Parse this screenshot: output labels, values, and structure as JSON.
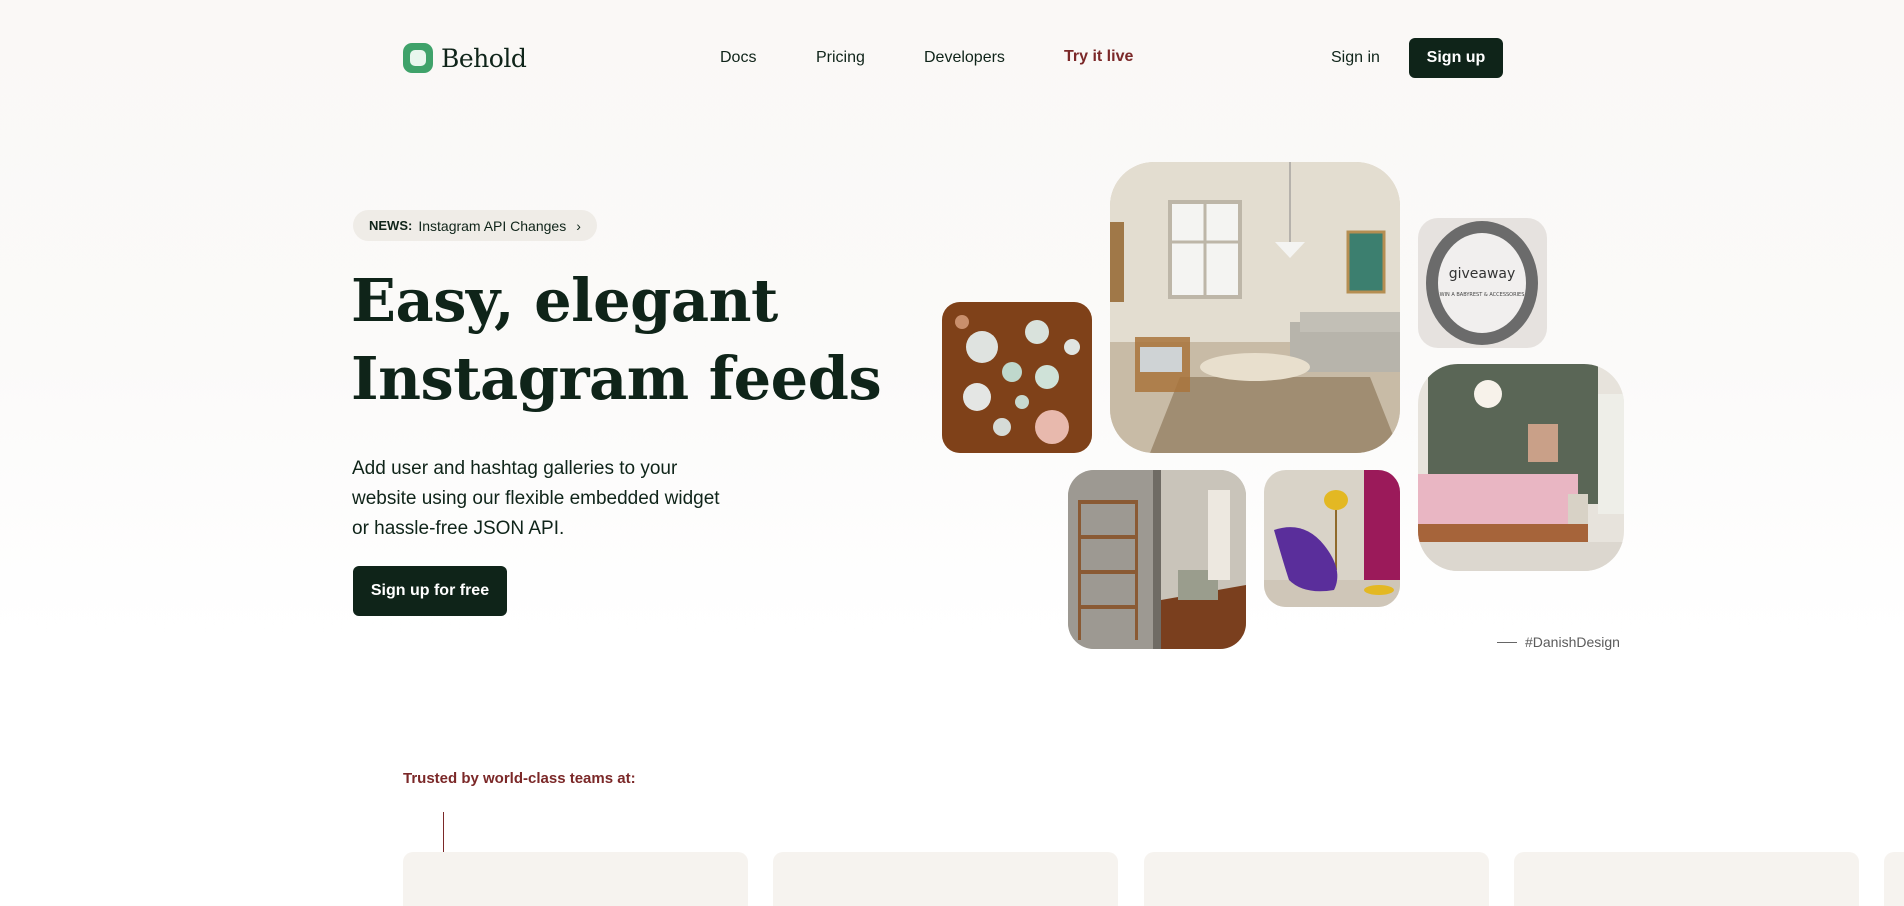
{
  "nav": {
    "brand": "Behold",
    "links": [
      {
        "label": "Docs"
      },
      {
        "label": "Pricing"
      },
      {
        "label": "Developers"
      },
      {
        "label": "Try it live"
      }
    ],
    "signin": "Sign in",
    "signup": "Sign up"
  },
  "hero": {
    "news_label": "NEWS:",
    "news_text": "Instagram API Changes",
    "title_line1": "Easy, elegant",
    "title_line2": "Instagram feeds",
    "subtitle": "Add user and hashtag galleries to your website using our flexible embedded widget or hassle-free JSON API.",
    "cta": "Sign up for free"
  },
  "gallery": {
    "caption": "#DanishDesign",
    "giveaway_text": "giveaway",
    "giveaway_sub": "WIN A BABYREST & ACCESSORIES"
  },
  "trusted": {
    "heading": "Trusted by world-class teams at:"
  },
  "colors": {
    "brand_green": "#3fa26a",
    "dark": "#0f2419",
    "accent": "#7b2828"
  }
}
